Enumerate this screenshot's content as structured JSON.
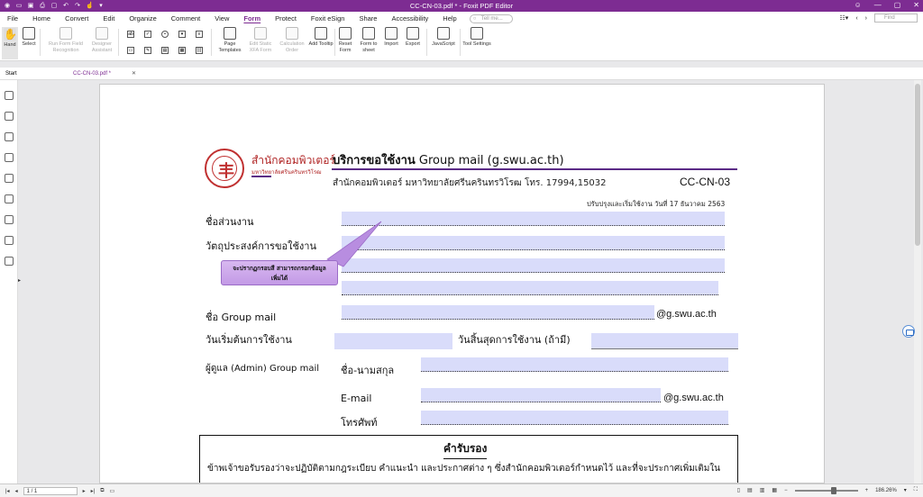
{
  "app": {
    "title": "CC-CN-03.pdf * - Foxit PDF Editor",
    "tell_me": "Tell me...",
    "find": "Find"
  },
  "menu": [
    "File",
    "Home",
    "Convert",
    "Edit",
    "Organize",
    "Comment",
    "View",
    "Form",
    "Protect",
    "Foxit eSign",
    "Share",
    "Accessibility",
    "Help"
  ],
  "ribbon": {
    "hand": "Hand",
    "select": "Select",
    "run_form": "Run Form Field Recognition",
    "designer": "Designer Assistant",
    "page_templates": "Page Templates",
    "edit_static": "Edit Static XFA Form",
    "calc_order": "Calculation Order",
    "add_tooltip": "Add Tooltip",
    "reset_form": "Reset Form",
    "form_to_sheet": "Form to sheet",
    "import": "Import",
    "export": "Export",
    "javascript": "JavaScript",
    "tool_settings": "Tool Settings"
  },
  "tabs": {
    "start": "Start",
    "doc": "CC-CN-03.pdf *"
  },
  "doc": {
    "org_name": "สำนักคอมพิวเตอร์",
    "org_sub": "มหาวิทยาลัยศรีนครินทรวิโรฒ",
    "header_bold": "บริการขอใช้งาน",
    "header_rest": " Group mail (g.swu.ac.th)",
    "subheader": "สำนักคอมพิวเตอร์ มหาวิทยาลัยศรีนครินทรวิโรฒ โทร. 17994,15032",
    "code": "CC-CN-03",
    "updated": "ปรับปรุงและเริ่มใช้งาน วันที่ 17 ธันวาคม 2563",
    "label_dept": "ชื่อส่วนงาน",
    "label_purpose": "วัตถุประสงค์การขอใช้งาน",
    "label_group_mail": "ชื่อ Group mail",
    "suffix_domain": "@g.swu.ac.th",
    "label_start": "วันเริ่มต้นการใช้งาน",
    "label_end": "วันสิ้นสุดการใช้งาน (ถ้ามี)",
    "label_admin": "ผู้ดูแล (Admin) Group mail",
    "label_name": "ชื่อ-นามสกุล",
    "label_email": "E-mail",
    "label_phone": "โทรศัพท์",
    "callout_line1": "จะปรากฏกรอบสี สามารถกรอกข้อมูล",
    "callout_line2": "เพิ่มได้",
    "cert_title": "คำรับรอง",
    "cert_text": "ข้าพเจ้าขอรับรองว่าจะปฏิบัติตามกฎระเบียบ คำแนะนำ และประกาศต่าง ๆ ซึ่งสำนักคอมพิวเตอร์กำหนดไว้ และที่จะประกาศเพิ่มเติมใน"
  },
  "status": {
    "page": "1 / 1",
    "zoom": "186.26%"
  },
  "colors": {
    "accent": "#7d2c92",
    "field": "#d9dcfa"
  }
}
